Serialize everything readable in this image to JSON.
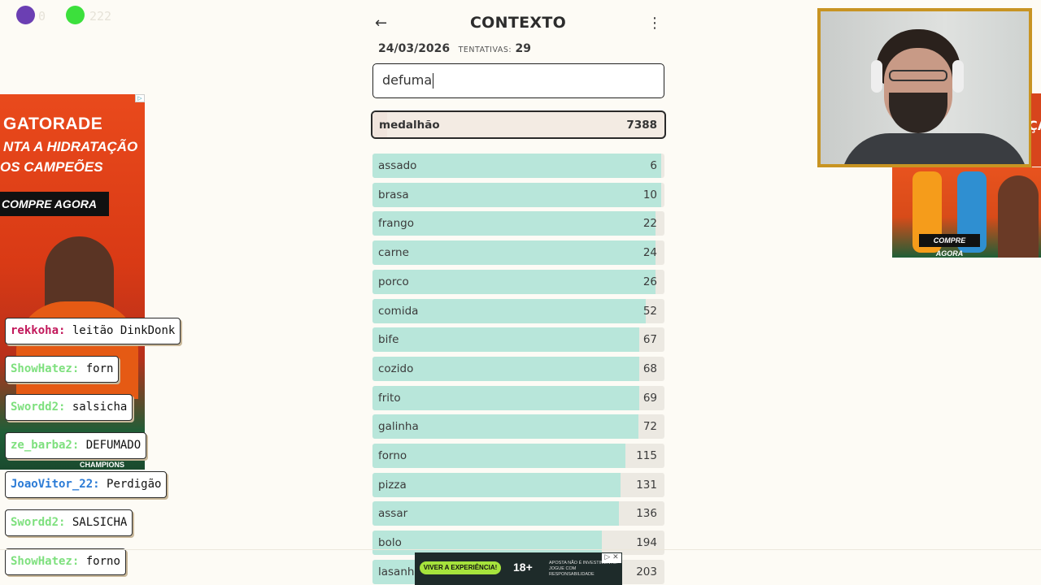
{
  "overlay": {
    "purple_count": "0",
    "green_count": "222"
  },
  "game": {
    "title": "CONTEXTO",
    "date": "24/03/2026",
    "attempts_label": "TENTATIVAS:",
    "attempts": "29",
    "input_value": "defuma",
    "last_guess": {
      "word": "medalhão",
      "rank": "7388",
      "fill": 0.05
    },
    "guesses": [
      {
        "word": "assado",
        "rank": "6",
        "fill": 0.99
      },
      {
        "word": "brasa",
        "rank": "10",
        "fill": 0.99
      },
      {
        "word": "frango",
        "rank": "22",
        "fill": 0.97
      },
      {
        "word": "carne",
        "rank": "24",
        "fill": 0.97
      },
      {
        "word": "porco",
        "rank": "26",
        "fill": 0.97
      },
      {
        "word": "comida",
        "rank": "52",
        "fill": 0.935
      },
      {
        "word": "bife",
        "rank": "67",
        "fill": 0.915
      },
      {
        "word": "cozido",
        "rank": "68",
        "fill": 0.915
      },
      {
        "word": "frito",
        "rank": "69",
        "fill": 0.915
      },
      {
        "word": "galinha",
        "rank": "72",
        "fill": 0.91
      },
      {
        "word": "forno",
        "rank": "115",
        "fill": 0.865
      },
      {
        "word": "pizza",
        "rank": "131",
        "fill": 0.85
      },
      {
        "word": "assar",
        "rank": "136",
        "fill": 0.845
      },
      {
        "word": "bolo",
        "rank": "194",
        "fill": 0.785
      },
      {
        "word": "lasanha",
        "rank": "203",
        "fill": 0.775
      }
    ]
  },
  "chat": [
    {
      "user": "rekkoha:",
      "message": "leitão DinkDonk",
      "color": "#c2185b"
    },
    {
      "user": "ShowHatez:",
      "message": "forn",
      "color": "#7ee07e"
    },
    {
      "user": "Swordd2:",
      "message": "salsicha",
      "color": "#7ee07e"
    },
    {
      "user": "ze_barba2:",
      "message": "DEFUMADO",
      "color": "#7ee07e"
    },
    {
      "user": "JoaoVitor_22:",
      "message": "Perdigão",
      "color": "#2b7bd6"
    },
    {
      "user": "Swordd2:",
      "message": "SALSICHA",
      "color": "#7ee07e"
    },
    {
      "user": "ShowHatez:",
      "message": "forno",
      "color": "#7ee07e"
    }
  ],
  "ad_left": {
    "brand": "GATORADE",
    "line1": "NTA A HIDRATAÇÃO",
    "line2": "OS CAMPEÕES",
    "cta": "COMPRE AGORA",
    "footer": "CHAMPIONS"
  },
  "ad_right": {
    "cta": "COMPRE AGORA",
    "edge": "ÇA"
  },
  "ad_bottom": {
    "button": "VIVER A EXPERIÊNCIA!",
    "age": "18+",
    "fine_print": "APOSTA NÃO É INVESTIMENTO. JOGUE COM RESPONSABILIDADE"
  },
  "colors": {
    "bar_fill": "#b8e6da",
    "bar_track": "#ece9e2",
    "frame_gold": "#c89422"
  }
}
